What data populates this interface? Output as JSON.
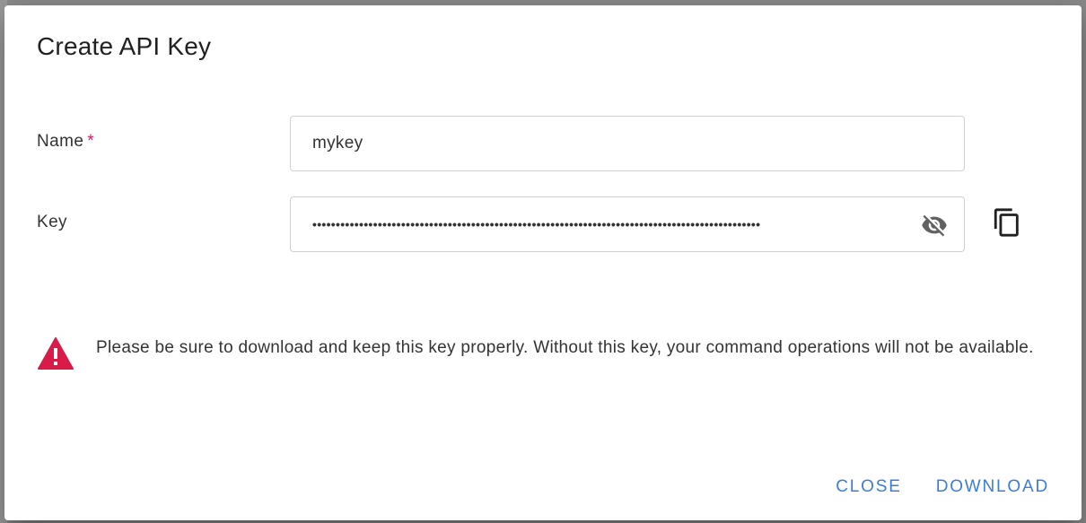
{
  "dialog": {
    "title": "Create API Key",
    "name_label": "Name",
    "required_mark": "*",
    "name_value": "mykey",
    "key_label": "Key",
    "key_masked": "••••••••••••••••••••••••••••••••••••••••••••••••••••••••••••••••••••••••••••••••••••••••••••••••",
    "warning_text": "Please be sure to download and keep this key properly. Without this key, your command operations will not be available.",
    "close_label": "CLOSE",
    "download_label": "DOWNLOAD"
  },
  "icons": {
    "visibility_toggle": "visibility-off-icon",
    "copy": "copy-icon",
    "warning": "warning-icon"
  },
  "colors": {
    "accent": "#3b7dd8",
    "warning": "#d81b48",
    "required": "#d81b60"
  }
}
